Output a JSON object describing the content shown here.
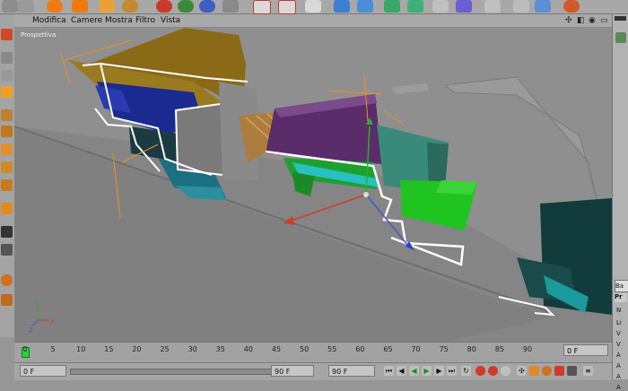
{
  "menu": {
    "items": [
      "Modifica",
      "Camere",
      "Mostra",
      "Filtro",
      "Vista"
    ]
  },
  "viewport": {
    "label": "Prospettiva",
    "axis": {
      "x": "X",
      "y": "Y",
      "z": "Z"
    }
  },
  "timeline": {
    "ticks": [
      "0",
      "5",
      "10",
      "15",
      "20",
      "25",
      "30",
      "35",
      "40",
      "45",
      "50",
      "55",
      "60",
      "65",
      "70",
      "75",
      "80",
      "85",
      "90"
    ],
    "right_field": "0 F"
  },
  "bottombar": {
    "start_field": "0 F",
    "end_field": "90 F",
    "current_field": "90 F"
  },
  "right_panel": {
    "tab_label": "Ba",
    "props_label": "Pr",
    "rows": [
      "N",
      "Li",
      "V",
      "V",
      "A",
      "A",
      "A",
      "A"
    ]
  },
  "icons": {
    "toolbar": [
      "undo-icon",
      "live-select-icon",
      "move-icon",
      "scale-icon",
      "rotate-icon",
      "x-axis-icon",
      "y-axis-icon",
      "z-axis-icon",
      "world-coord-icon",
      "render-view-icon",
      "render-picture-viewer-icon",
      "render-settings-icon",
      "cube-icon",
      "spline-icon",
      "nurbs-icon",
      "array-icon",
      "deformer-icon",
      "scene-icon",
      "camera-icon",
      "light-icon",
      "cursor-icon",
      "paint-icon"
    ],
    "accent_colors": {
      "orange": "#f07a10",
      "blue": "#2d5fd6",
      "teal": "#2aa39a",
      "red": "#d03a2a"
    }
  }
}
